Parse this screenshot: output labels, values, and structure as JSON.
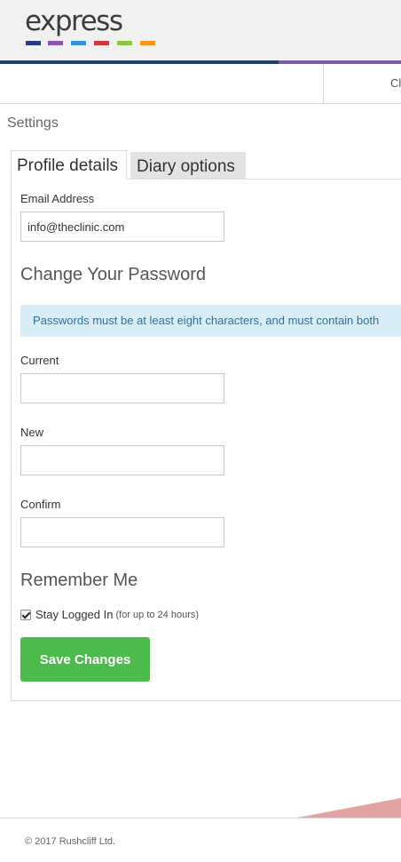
{
  "brand": {
    "logo_text": "express",
    "bar_colors": [
      "#283e84",
      "#8a55b3",
      "#3c8fd6",
      "#cc3a3a",
      "#8dc63f",
      "#f7941d"
    ],
    "stripe_colors": [
      "#1f3f6b",
      "#7b5ea7"
    ]
  },
  "nav": {
    "partial_item": "Cl"
  },
  "breadcrumb": "Settings",
  "tabs": [
    {
      "label": "Profile details",
      "active": true
    },
    {
      "label": "Diary options",
      "active": false
    }
  ],
  "form": {
    "email": {
      "label": "Email Address",
      "value": "info@theclinic.com"
    },
    "password_section_title": "Change Your Password",
    "password_notice": "Passwords must be at least eight characters, and must contain both",
    "current": {
      "label": "Current",
      "value": ""
    },
    "new": {
      "label": "New",
      "value": ""
    },
    "confirm": {
      "label": "Confirm",
      "value": ""
    },
    "remember_section_title": "Remember Me",
    "stay_logged_in": {
      "label": "Stay Logged In",
      "note": "(for up to 24 hours)",
      "checked": true
    },
    "save_button": "Save Changes",
    "save_button_color": "#4cbb4c"
  },
  "footer": {
    "copyright": "© 2017 Rushcliff Ltd."
  }
}
